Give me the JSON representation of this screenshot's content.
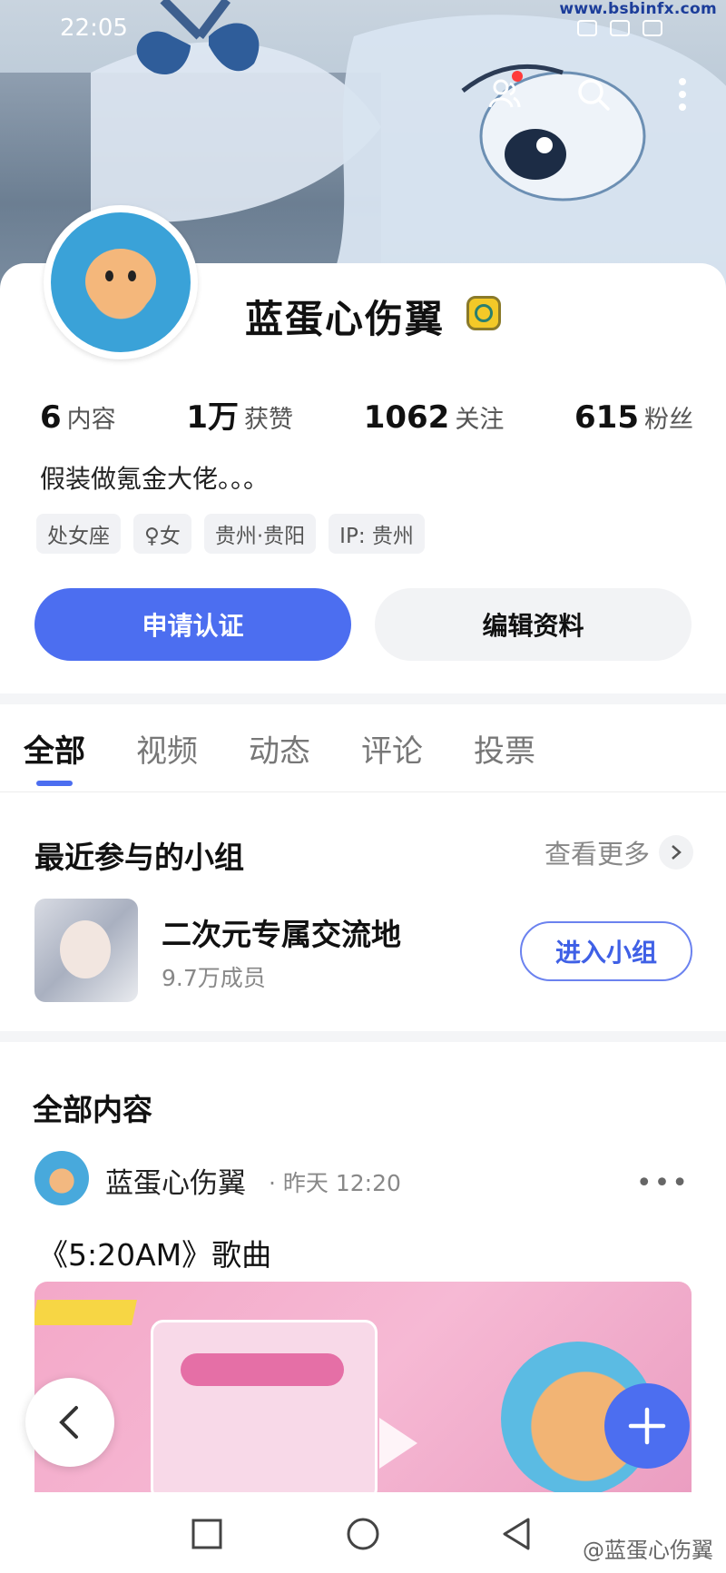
{
  "watermark_top": "www.bsbinfx.com",
  "status_bar": {
    "time": "22:05"
  },
  "profile": {
    "username": "蓝蛋心伤翼",
    "stats": [
      {
        "num": "6",
        "label": "内容"
      },
      {
        "num": "1万",
        "label": "获赞"
      },
      {
        "num": "1062",
        "label": "关注"
      },
      {
        "num": "615",
        "label": "粉丝"
      }
    ],
    "bio": "假装做氪金大佬。。。",
    "tags": [
      "处女座",
      "♀女",
      "贵州·贵阳",
      "IP: 贵州"
    ],
    "primary_button": "申请认证",
    "secondary_button": "编辑资料"
  },
  "tabs": [
    "全部",
    "视频",
    "动态",
    "评论",
    "投票"
  ],
  "groups_section": {
    "title": "最近参与的小组",
    "see_more": "查看更多",
    "group": {
      "name": "二次元专属交流地",
      "members": "9.7万成员",
      "join_label": "进入小组"
    }
  },
  "content_section": {
    "title": "全部内容",
    "post": {
      "author": "蓝蛋心伤翼",
      "time": "· 昨天 12:20",
      "title": "《5:20AM》歌曲"
    }
  },
  "watermark_bottom": "@蓝蛋心伤翼",
  "colors": {
    "accent": "#4c6ef0",
    "tag_bg": "#f1f2f5"
  }
}
